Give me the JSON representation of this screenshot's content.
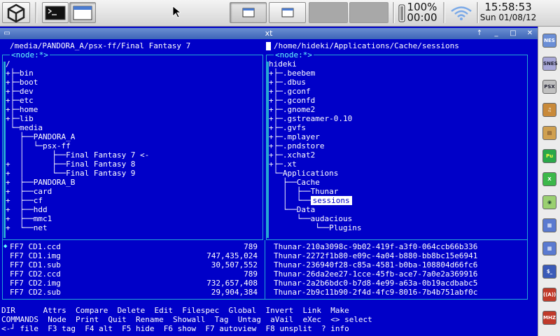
{
  "topbar": {
    "battery_percent": "100%",
    "battery_time": "00:00",
    "time": "15:58:53",
    "date": "Sun 01/08/12"
  },
  "window": {
    "title": "xt",
    "minimize_label": "↑",
    "restore_label": "_",
    "maximize_label": "□",
    "close_label": "✕"
  },
  "left_panel": {
    "path": "/media/PANDORA_A/psx-ff/Final Fantasy 7",
    "node_label": "<node:*>",
    "tree": [
      {
        "prefix": "/",
        "name": "",
        "suffix": ""
      },
      {
        "prefix": "+├─",
        "name": "bin",
        "suffix": ""
      },
      {
        "prefix": "+├─",
        "name": "boot",
        "suffix": ""
      },
      {
        "prefix": "+├─",
        "name": "dev",
        "suffix": ""
      },
      {
        "prefix": "+├─",
        "name": "etc",
        "suffix": ""
      },
      {
        "prefix": "+├─",
        "name": "home",
        "suffix": ""
      },
      {
        "prefix": "+├─",
        "name": "lib",
        "suffix": ""
      },
      {
        "prefix": " └─",
        "name": "media",
        "suffix": ""
      },
      {
        "prefix": "   ├──",
        "name": "PANDORA_A",
        "suffix": ""
      },
      {
        "prefix": "   │  └─",
        "name": "psx-ff",
        "suffix": ""
      },
      {
        "prefix": "   │      ├──",
        "name": "Final Fantasy 7",
        "suffix": " <-"
      },
      {
        "prefix": "+  │      ├──",
        "name": "Final Fantasy 8",
        "suffix": ""
      },
      {
        "prefix": "+  │      └──",
        "name": "Final Fantasy 9",
        "suffix": ""
      },
      {
        "prefix": "+  ├──",
        "name": "PANDORA_B",
        "suffix": ""
      },
      {
        "prefix": "+  ├──",
        "name": "card",
        "suffix": ""
      },
      {
        "prefix": "+  ├──",
        "name": "cf",
        "suffix": ""
      },
      {
        "prefix": "+  ├──",
        "name": "hdd",
        "suffix": ""
      },
      {
        "prefix": "+  ├──",
        "name": "mmc1",
        "suffix": ""
      },
      {
        "prefix": "+  └──",
        "name": "net",
        "suffix": ""
      }
    ],
    "files": [
      {
        "name": "FF7 CD1.ccd",
        "size": "789"
      },
      {
        "name": "FF7 CD1.img",
        "size": "747,435,024"
      },
      {
        "name": "FF7 CD1.sub",
        "size": "30,507,552"
      },
      {
        "name": "FF7 CD2.ccd",
        "size": "789"
      },
      {
        "name": "FF7 CD2.img",
        "size": "732,657,408"
      },
      {
        "name": "FF7 CD2.sub",
        "size": "29,904,384"
      }
    ]
  },
  "right_panel": {
    "path": "/home/hideki/Applications/Cache/sessions",
    "node_label": "<node:*>",
    "tree": [
      {
        "prefix": "",
        "name": "hideki",
        "suffix": ""
      },
      {
        "prefix": "+├─",
        "name": ".beebem",
        "suffix": ""
      },
      {
        "prefix": "+├─",
        "name": ".dbus",
        "suffix": ""
      },
      {
        "prefix": "+├─",
        "name": ".gconf",
        "suffix": ""
      },
      {
        "prefix": "+├─",
        "name": ".gconfd",
        "suffix": ""
      },
      {
        "prefix": "+├─",
        "name": ".gnome2",
        "suffix": ""
      },
      {
        "prefix": "+├─",
        "name": ".gstreamer-0.10",
        "suffix": ""
      },
      {
        "prefix": "+├─",
        "name": ".gvfs",
        "suffix": ""
      },
      {
        "prefix": "+├─",
        "name": ".mplayer",
        "suffix": ""
      },
      {
        "prefix": "+├─",
        "name": ".pndstore",
        "suffix": ""
      },
      {
        "prefix": "+├─",
        "name": ".xchat2",
        "suffix": ""
      },
      {
        "prefix": "+├─",
        "name": ".xt",
        "suffix": ""
      },
      {
        "prefix": " └─",
        "name": "Applications",
        "suffix": ""
      },
      {
        "prefix": "   ├──",
        "name": "Cache",
        "suffix": ""
      },
      {
        "prefix": "   │  ├──",
        "name": "Thunar",
        "suffix": ""
      },
      {
        "prefix": "   │  └──",
        "name": "sessions",
        "suffix": "",
        "selected": true
      },
      {
        "prefix": "   └──",
        "name": "Data",
        "suffix": ""
      },
      {
        "prefix": "      └──",
        "name": "audacious",
        "suffix": ""
      },
      {
        "prefix": "          └──",
        "name": "Plugins",
        "suffix": ""
      }
    ],
    "files": [
      {
        "name": "Thunar-210a3098c-9b02-419f-a3f0-064ccb66b336"
      },
      {
        "name": "Thunar-2272f1b80-e09c-4a04-b880-bb8bc15e6941"
      },
      {
        "name": "Thunar-236940f28-c85a-4581-b0ba-108804d66fc6"
      },
      {
        "name": "Thunar-26da2ee27-1cce-45fb-ace7-7a0e2a369916"
      },
      {
        "name": "Thunar-2a2b6bdc0-b7d8-4e99-a63a-0b19acdbabc5"
      },
      {
        "name": "Thunar-2b9c11b90-2f4d-4fc9-8016-7b4b751abf0c"
      }
    ]
  },
  "command_lines": [
    "DIR      Attrs  Compare  Delete  Edit  Filespec  Global  Invert  Link  Make",
    "COMMANDS  Node  Print  Quit  Rename  Showall  Tag  Untag  aVail  eXec  <> select",
    "<-┘ file  F3 tag  F4 alt  F5 hide  F6 show  F7 autoview  F8 unsplit  ? info"
  ],
  "dock": [
    {
      "label": "NES",
      "icon": "nes-icon"
    },
    {
      "label": "SNES",
      "icon": "snes-icon"
    },
    {
      "label": "PSX",
      "icon": "psx-icon"
    },
    {
      "label": "♫",
      "icon": "music-icon"
    },
    {
      "label": "▤",
      "icon": "film-icon"
    },
    {
      "label": "Pu",
      "icon": "putty-icon"
    },
    {
      "label": "X",
      "icon": "xchat-icon"
    },
    {
      "label": "◉",
      "icon": "globe-icon"
    },
    {
      "label": "▦",
      "icon": "window-icon"
    },
    {
      "label": "▦",
      "icon": "window2-icon"
    },
    {
      "label": "$_",
      "icon": "terminal-icon"
    },
    {
      "label": "((A))",
      "icon": "antenna-icon"
    },
    {
      "label": "MHZ",
      "icon": "mhz-icon"
    }
  ],
  "colors": {
    "terminal_bg": "#0000c8",
    "terminal_fg": "#ffffff",
    "frame": "#26a6d4"
  }
}
